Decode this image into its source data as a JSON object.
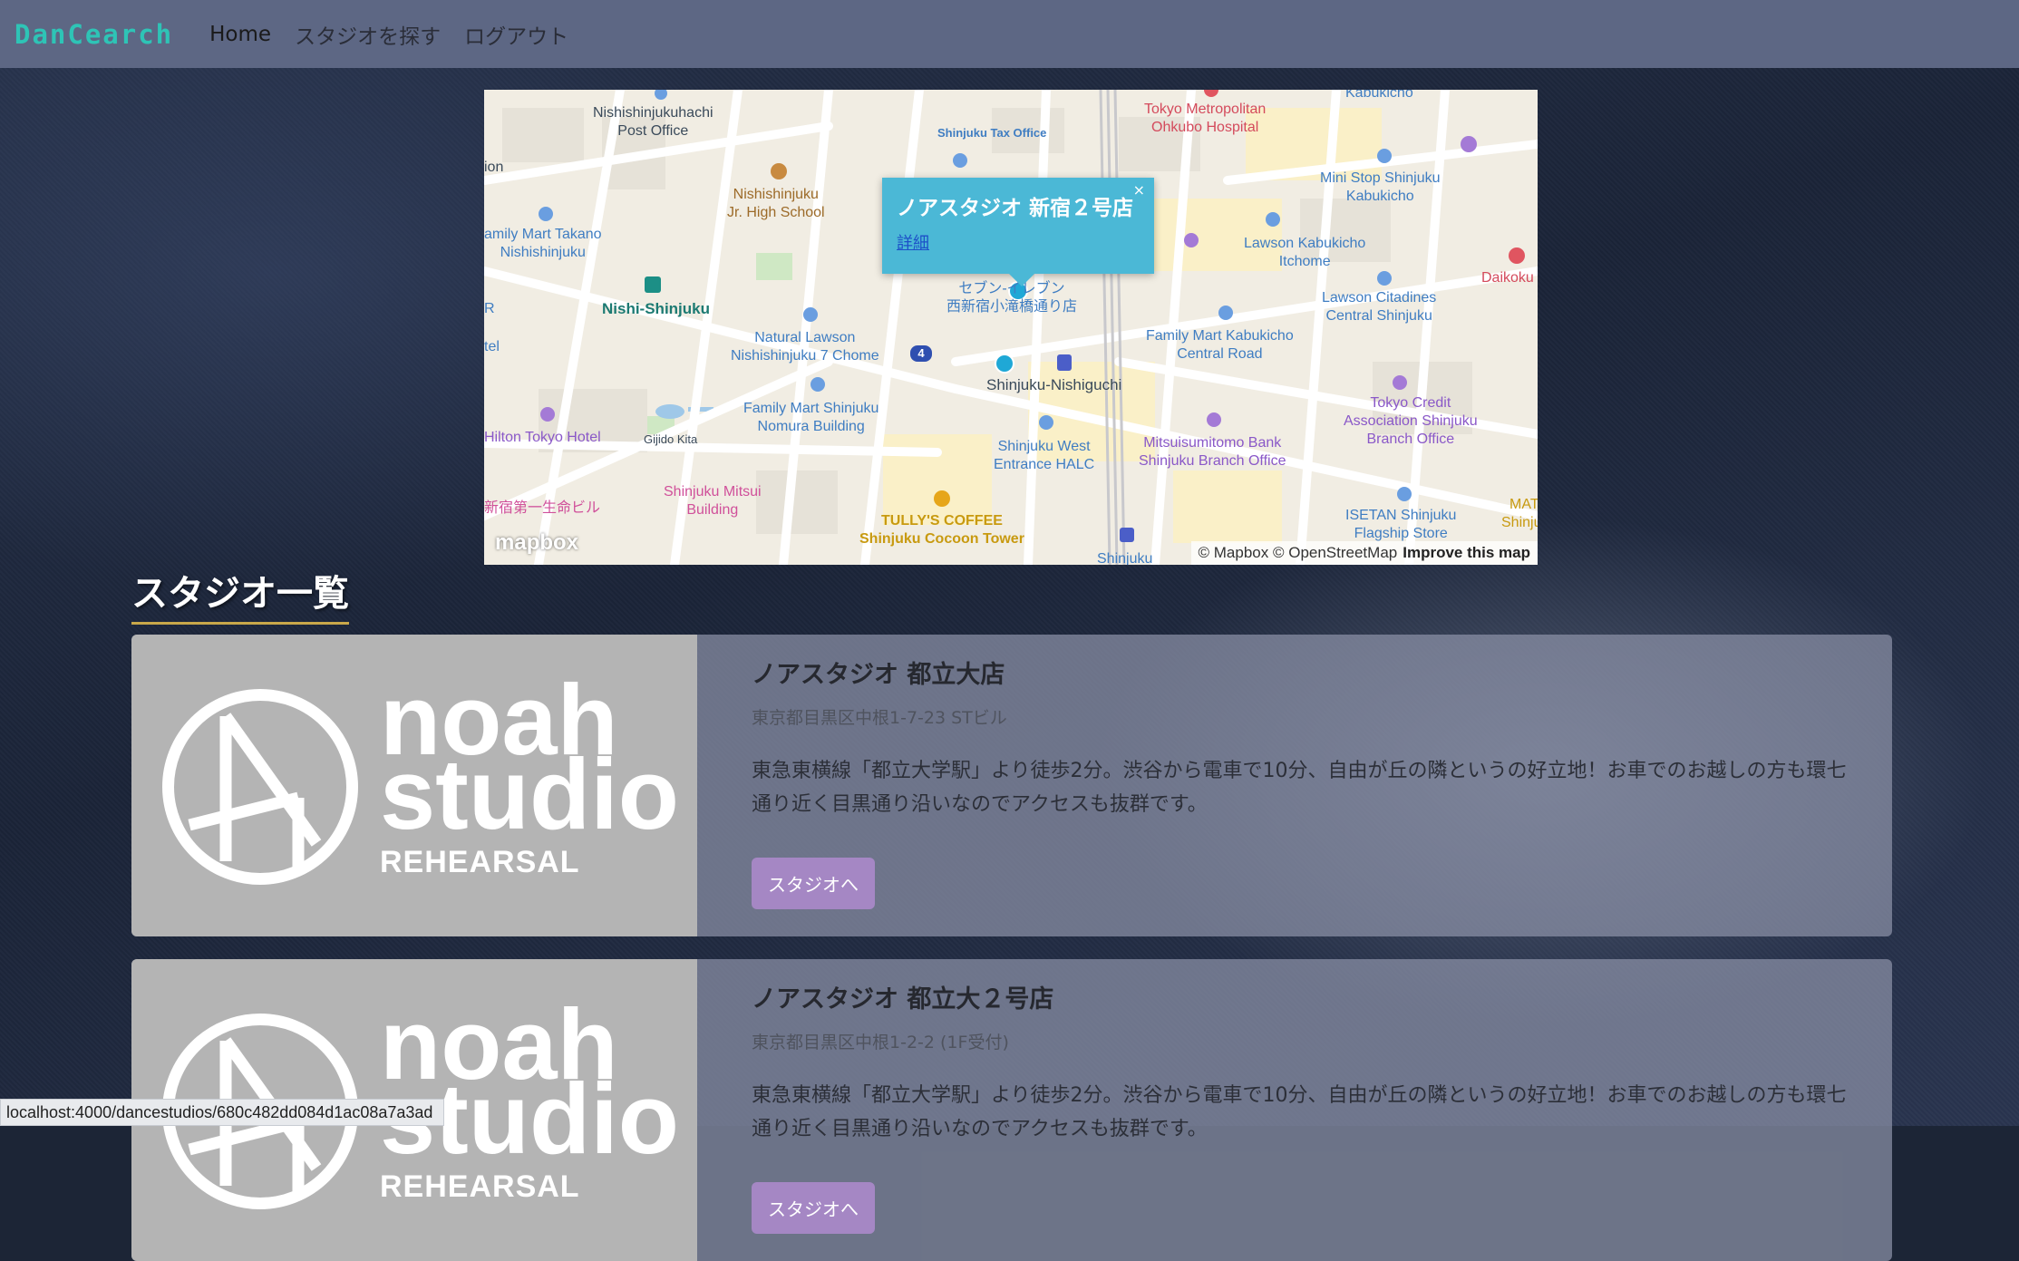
{
  "navbar": {
    "brand": "DanCearch",
    "links": [
      "Home",
      "スタジオを探す",
      "ログアウト"
    ]
  },
  "map": {
    "labels": {
      "post_office": "Nishishinjukuhachi\nPost Office",
      "tax_office": "Shinjuku Tax Office",
      "hospital": "Tokyo Metropolitan\nOhkubo Hospital",
      "kabukicho_top": "Kabukicho",
      "ministop": "Mini Stop Shinjuku\nKabukicho",
      "school": "Nishishinjuku\nJr. High School",
      "famima_takano": "amily Mart Takano\nNishishinjuku",
      "lawson_1": "Lawson Kabukicho\nItchome",
      "daikoku": "Daikoku D",
      "nishi_shinjuku": "Nishi-Shinjuku",
      "seven_eleven": "セブン-イレブン\n西新宿小滝橋通り店",
      "lawson_citadines": "Lawson Citadines\nCentral Shinjuku",
      "natural_lawson": "Natural Lawson\nNishishinjuku 7 Chome",
      "famima_central": "Family Mart Kabukicho\nCentral Road",
      "shinjuku_nishiguchi": "Shinjuku-Nishiguchi",
      "famima_nomura": "Family Mart Shinjuku\nNomura Building",
      "tokyo_credit": "Tokyo Credit\nAssociation Shinjuku\nBranch Office",
      "hilton": "Hilton Tokyo Hotel",
      "gijido": "Gijido Kita",
      "halc": "Shinjuku West\nEntrance HALC",
      "smbc": "Mitsuisumitomo Bank\nShinjuku Branch Office",
      "seimei": "新宿第一生命ビル",
      "mitsui": "Shinjuku Mitsui\nBuilding",
      "tullys": "TULLY'S COFFEE\nShinjuku Cocoon Tower",
      "isetan": "ISETAN Shinjuku\nFlagship Store",
      "shinjuku_bottom": "Shinjuku",
      "mats": "MATS\nShinjuku",
      "ion": "ion",
      "r": "R",
      "tel": "tel",
      "route": "4"
    },
    "popup": {
      "title": "ノアスタジオ 新宿２号店",
      "link": "詳細",
      "close": "×"
    },
    "logo": "mapbox",
    "attribution": "© Mapbox © OpenStreetMap",
    "improve": "Improve this map"
  },
  "section_title": "スタジオ一覧",
  "logo_text": {
    "line1": "noah",
    "line2": "studio",
    "line3": "REHEARSAL"
  },
  "studios": [
    {
      "name": "ノアスタジオ 都立大店",
      "address": "東京都目黒区中根1-7-23 STビル",
      "description": "東急東横線「都立大学駅」より徒歩2分。渋谷から電車で10分、自由が丘の隣というの好立地！お車でのお越しの方も環七通り近く目黒通り沿いなのでアクセスも抜群です。",
      "button": "スタジオへ"
    },
    {
      "name": "ノアスタジオ 都立大２号店",
      "address": "東京都目黒区中根1-2-2 (1F受付)",
      "description": "東急東横線「都立大学駅」より徒歩2分。渋谷から電車で10分、自由が丘の隣というの好立地！お車でのお越しの方も環七通り近く目黒通り沿いなのでアクセスも抜群です。",
      "button": "スタジオへ"
    }
  ],
  "status_url": "localhost:4000/dancestudios/680c482dd084d1ac08a7a3ad",
  "colors": {
    "navbar": "#5d6784",
    "brand": "#2ec4b6",
    "popup": "#4bb8d6",
    "button": "#a587c4",
    "title_underline": "#c9a84a"
  }
}
